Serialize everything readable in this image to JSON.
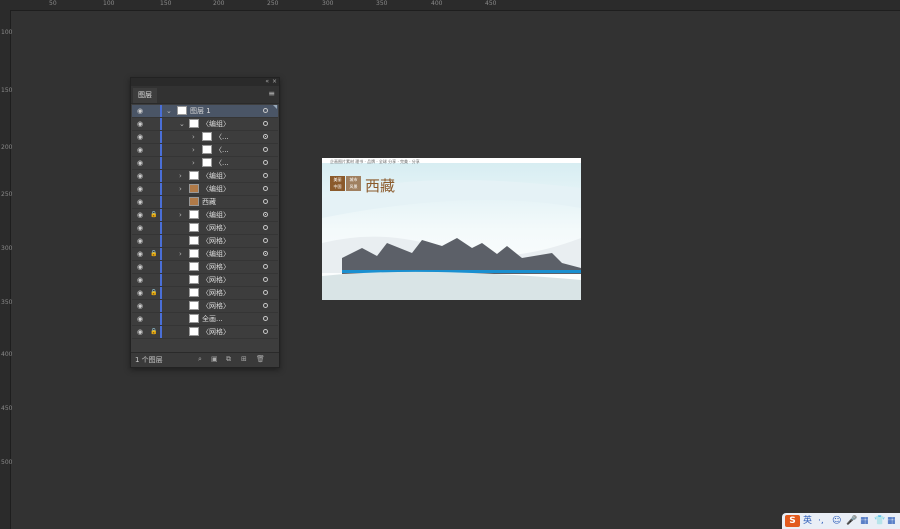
{
  "ruler": {
    "top_labels": [
      "50",
      "100",
      "150",
      "200",
      "250",
      "300",
      "350",
      "400",
      "450"
    ],
    "left_labels": [
      "100",
      "150",
      "200",
      "250",
      "300",
      "350",
      "400",
      "450",
      "500"
    ]
  },
  "layers_panel": {
    "collapse_glyph": "«",
    "close_glyph": "×",
    "tab_label": "图层",
    "menu_glyph": "≡",
    "rows": [
      {
        "label": "图层 1",
        "thumb": "white"
      },
      {
        "label": "〈编组〉",
        "thumb": "white"
      },
      {
        "label": "〈...",
        "thumb": "white"
      },
      {
        "label": "〈...",
        "thumb": "white"
      },
      {
        "label": "〈...",
        "thumb": "white"
      },
      {
        "label": "〈编组〉",
        "thumb": "white"
      },
      {
        "label": "〈编组〉",
        "thumb": "brown"
      },
      {
        "label": "西藏",
        "thumb": "brown"
      },
      {
        "label": "〈编组〉",
        "thumb": "white"
      },
      {
        "label": "〈网格〉",
        "thumb": "white"
      },
      {
        "label": "〈网格〉",
        "thumb": "white"
      },
      {
        "label": "〈编组〉",
        "thumb": "white"
      },
      {
        "label": "〈网格〉",
        "thumb": "white"
      },
      {
        "label": "〈网格〉",
        "thumb": "white"
      },
      {
        "label": "〈网格〉",
        "thumb": "white"
      },
      {
        "label": "〈网格〉",
        "thumb": "white"
      },
      {
        "label": "全画...",
        "thumb": "white"
      },
      {
        "label": "〈网格〉",
        "thumb": "white"
      }
    ],
    "footer_count": "1 个图层"
  },
  "artboard": {
    "top_text": "企画图片素材 理书 · 品牌 · 全球 分享 · 完美 · 分享",
    "logo_text": [
      "美丽",
      "中国"
    ],
    "logo2_text": [
      "城市",
      "风景"
    ],
    "title": "西藏"
  },
  "tray": {
    "ime_logo": "S",
    "lang": "英",
    "icons": [
      "·,",
      "☺",
      "🎤",
      "▦",
      "👕",
      "▦"
    ]
  }
}
